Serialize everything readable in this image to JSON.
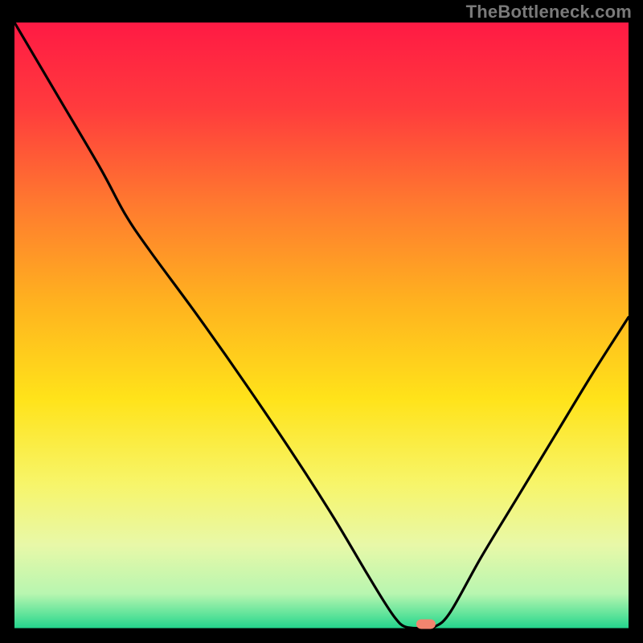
{
  "watermark": "TheBottleneck.com",
  "chart_data": {
    "type": "line",
    "title": "",
    "xlabel": "",
    "ylabel": "",
    "xlim": [
      0,
      100
    ],
    "ylim": [
      0,
      100
    ],
    "grid": false,
    "gradient_stops": [
      {
        "offset": 0.0,
        "color": "#ff1a44"
      },
      {
        "offset": 0.14,
        "color": "#ff3b3d"
      },
      {
        "offset": 0.3,
        "color": "#ff7a2f"
      },
      {
        "offset": 0.46,
        "color": "#ffb21f"
      },
      {
        "offset": 0.62,
        "color": "#ffe31a"
      },
      {
        "offset": 0.76,
        "color": "#f7f56a"
      },
      {
        "offset": 0.86,
        "color": "#e8f8a8"
      },
      {
        "offset": 0.94,
        "color": "#b8f6b0"
      },
      {
        "offset": 0.975,
        "color": "#5de39a"
      },
      {
        "offset": 1.0,
        "color": "#1bd38b"
      }
    ],
    "curve": [
      {
        "x": 0.0,
        "y": 100.0
      },
      {
        "x": 7.0,
        "y": 88.0
      },
      {
        "x": 14.0,
        "y": 76.0
      },
      {
        "x": 18.0,
        "y": 68.5
      },
      {
        "x": 22.0,
        "y": 62.5
      },
      {
        "x": 30.0,
        "y": 51.5
      },
      {
        "x": 38.0,
        "y": 40.0
      },
      {
        "x": 46.0,
        "y": 28.0
      },
      {
        "x": 52.0,
        "y": 18.5
      },
      {
        "x": 57.0,
        "y": 10.0
      },
      {
        "x": 60.0,
        "y": 5.0
      },
      {
        "x": 62.0,
        "y": 2.0
      },
      {
        "x": 63.5,
        "y": 0.6
      },
      {
        "x": 66.0,
        "y": 0.3
      },
      {
        "x": 68.5,
        "y": 0.6
      },
      {
        "x": 71.0,
        "y": 3.0
      },
      {
        "x": 76.0,
        "y": 12.0
      },
      {
        "x": 82.0,
        "y": 22.0
      },
      {
        "x": 88.0,
        "y": 32.0
      },
      {
        "x": 94.0,
        "y": 42.0
      },
      {
        "x": 100.0,
        "y": 51.5
      }
    ],
    "marker": {
      "x": 67.0,
      "y": 1.0,
      "color": "#f2856f"
    }
  }
}
